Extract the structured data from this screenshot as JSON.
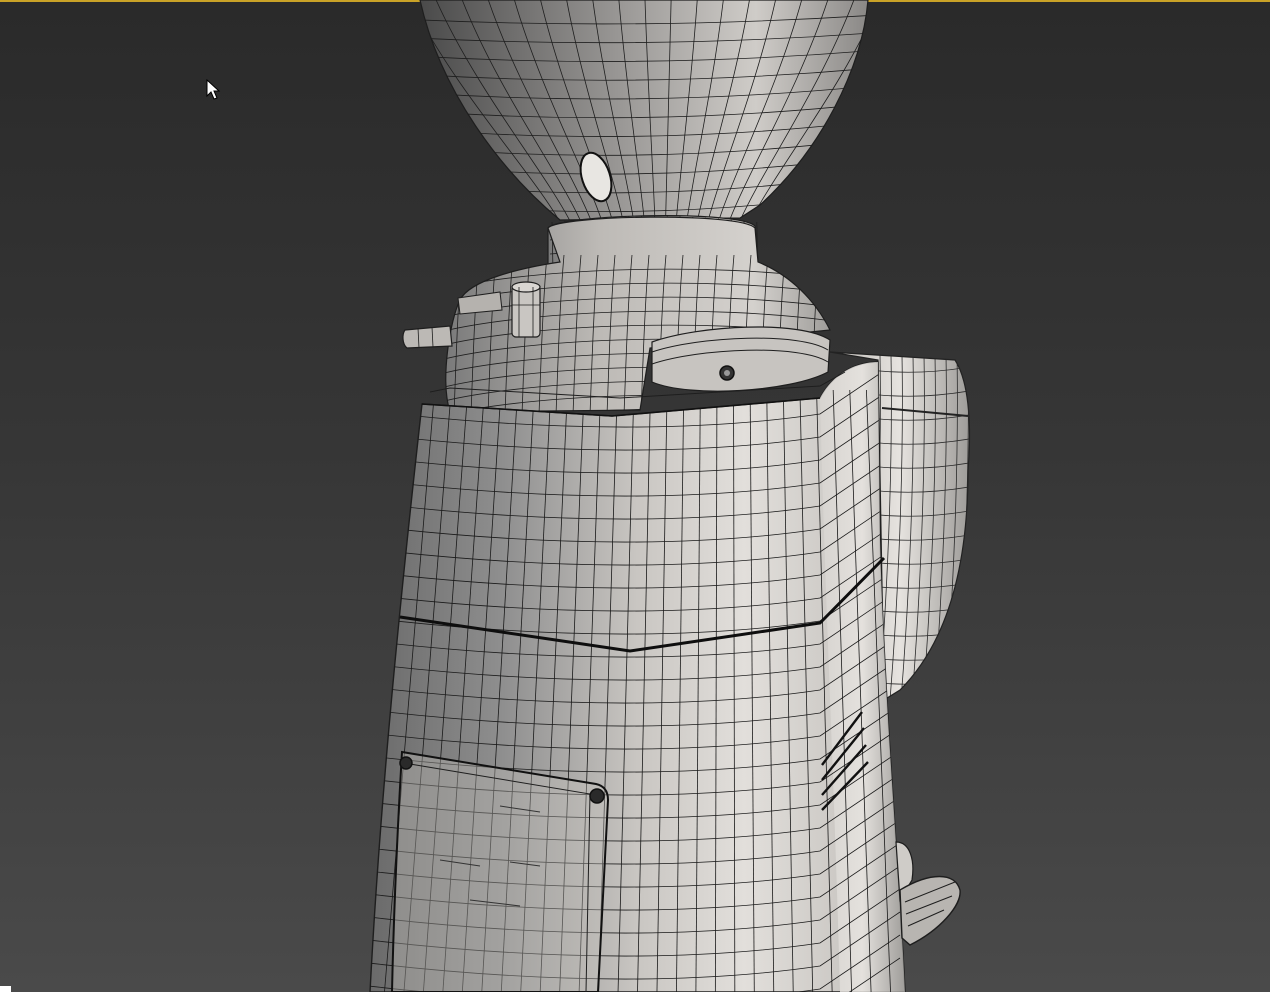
{
  "viewport": {
    "active": true,
    "shading": "wireframe-on-shaded",
    "border_color": "#c9a227",
    "background_top": "#2a2a2a",
    "background_bottom": "#4a4a4a"
  },
  "model": {
    "subject": "coffee-grinder-icon",
    "parts": [
      "hopper",
      "collar",
      "neck",
      "body",
      "front-panel",
      "portafilter-fork",
      "side-bin"
    ]
  },
  "cursor": {
    "icon": "arrow-pointer-icon"
  }
}
